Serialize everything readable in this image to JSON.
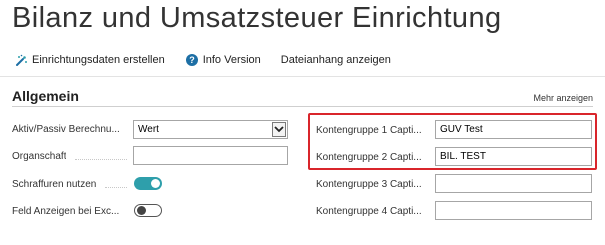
{
  "page": {
    "title": "Bilanz und Umsatzsteuer Einrichtung"
  },
  "actions": [
    {
      "label": "Einrichtungsdaten erstellen",
      "icon": "setup-wizard-icon"
    },
    {
      "label": "Info Version",
      "icon": "help-circle-icon"
    },
    {
      "label": "Dateianhang anzeigen"
    }
  ],
  "section": {
    "title": "Allgemein",
    "more_label": "Mehr anzeigen"
  },
  "left_fields": [
    {
      "label": "Aktiv/Passiv Berechnu...",
      "value": "Wert",
      "type": "select"
    },
    {
      "label": "Organschaft",
      "value": "",
      "type": "text"
    },
    {
      "label": "Schraffuren nutzen",
      "checked": true,
      "type": "toggle"
    },
    {
      "label": "Feld Anzeigen bei Exc...",
      "checked": false,
      "type": "toggle"
    }
  ],
  "right_fields": [
    {
      "label": "Kontengruppe 1 Capti...",
      "value": "GUV Test"
    },
    {
      "label": "Kontengruppe 2 Capti...",
      "value": "BIL. TEST"
    },
    {
      "label": "Kontengruppe 3 Capti...",
      "value": ""
    },
    {
      "label": "Kontengruppe 4 Capti...",
      "value": ""
    }
  ],
  "colors": {
    "toggle_on": "#2e9fab",
    "highlight_border": "#d9252b",
    "help_icon": "#1d6fa5"
  }
}
